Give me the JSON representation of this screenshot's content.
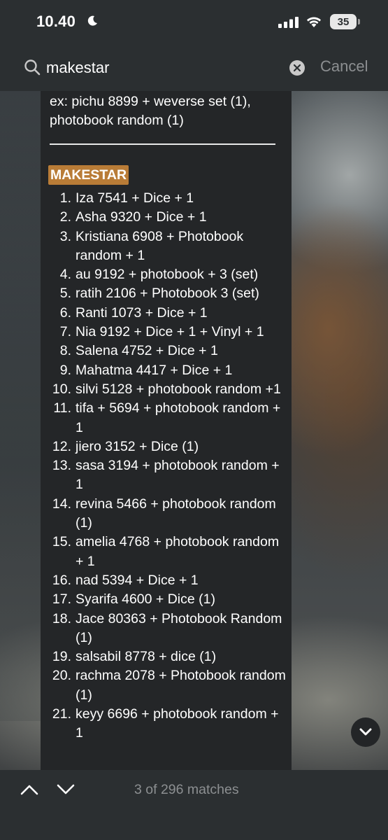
{
  "status_bar": {
    "time": "10.40",
    "battery": "35"
  },
  "search": {
    "query": "makestar",
    "cancel_label": "Cancel"
  },
  "content": {
    "example": "ex: pichu 8899 + weverse set (1), photobook random (1)",
    "highlight": "MAKESTAR",
    "entries": [
      {
        "num": "1.",
        "text": "Iza 7541 + Dice + 1"
      },
      {
        "num": "2.",
        "text": "Asha 9320 + Dice + 1"
      },
      {
        "num": "3.",
        "text": "Kristiana 6908 + Photobook random + 1"
      },
      {
        "num": "4.",
        "text": "au 9192 + photobook + 3 (set)"
      },
      {
        "num": "5.",
        "text": "ratih 2106 + Photobook 3 (set)"
      },
      {
        "num": "6.",
        "text": "Ranti 1073 + Dice + 1"
      },
      {
        "num": "7.",
        "text": "Nia 9192 + Dice + 1 + Vinyl + 1"
      },
      {
        "num": "8.",
        "text": "Salena 4752 + Dice + 1"
      },
      {
        "num": "9.",
        "text": "Mahatma 4417 + Dice + 1"
      },
      {
        "num": "10.",
        "text": "silvi 5128 + photobook random +1"
      },
      {
        "num": "11.",
        "text": "tifa + 5694 + photobook random + 1"
      },
      {
        "num": "12.",
        "text": "jiero 3152 + Dice (1)"
      },
      {
        "num": "13.",
        "text": "sasa 3194 + photobook random + 1"
      },
      {
        "num": "14.",
        "text": "revina 5466 + photobook random (1)"
      },
      {
        "num": "15.",
        "text": "amelia 4768 + photobook random + 1"
      },
      {
        "num": "16.",
        "text": "nad 5394 + Dice + 1"
      },
      {
        "num": "17.",
        "text": "Syarifa 4600 + Dice (1)"
      },
      {
        "num": "18.",
        "text": "Jace 80363 + Photobook Random (1)"
      },
      {
        "num": "19.",
        "text": "salsabil 8778 + dice (1)"
      },
      {
        "num": "20.",
        "text": "rachma 2078 + Photobook random (1)"
      },
      {
        "num": "21.",
        "text": "keyy 6696 + photobook random + 1"
      }
    ]
  },
  "find_bar": {
    "match_count": "3 of 296 matches"
  }
}
